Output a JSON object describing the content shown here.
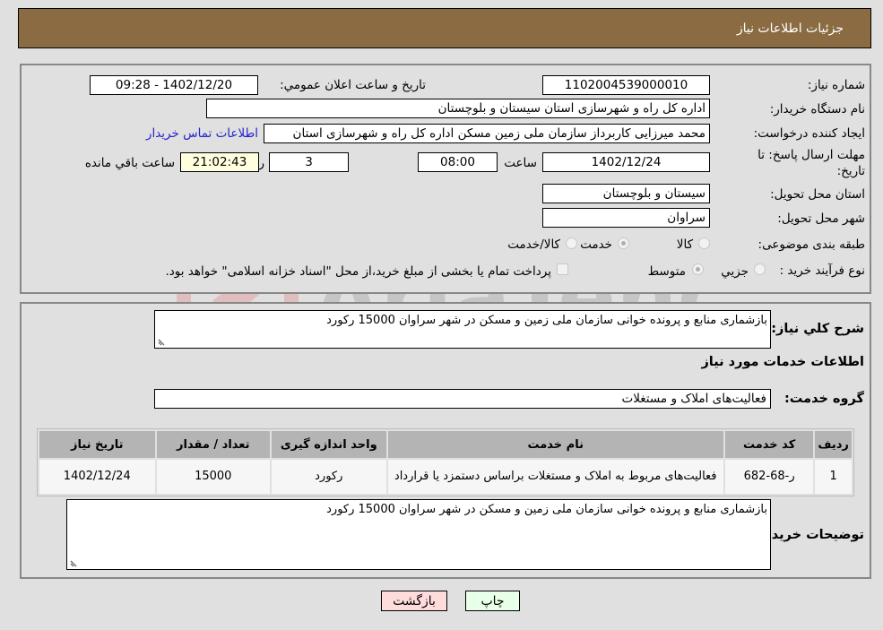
{
  "header": {
    "title": "جزئیات اطلاعات نیاز"
  },
  "form": {
    "need_number": {
      "label": "شماره نیاز:",
      "value": "1102004539000010"
    },
    "announce_datetime": {
      "label": "تاریخ و ساعت اعلان عمومي:",
      "value": "1402/12/20 - 09:28"
    },
    "buyer_org": {
      "label": "نام دستگاه خریدار:",
      "value": "اداره کل راه و شهرسازی استان سیستان و بلوچستان"
    },
    "requester": {
      "label": "ایجاد کننده درخواست:",
      "value": "محمد میرزایی کاربرداز سازمان ملی زمین مسکن اداره کل راه و شهرسازی استان"
    },
    "buyer_contact_link": "اطلاعات تماس خریدار",
    "deadline": {
      "label": "مهلت ارسال پاسخ: تا تاریخ:",
      "date": "1402/12/24",
      "time_label": "ساعت",
      "time": "08:00",
      "days": "3",
      "days_label": "روز و",
      "remaining": "21:02:43",
      "remaining_label": "ساعت باقي مانده"
    },
    "delivery_province": {
      "label": "استان محل تحویل:",
      "value": "سیستان و بلوچستان"
    },
    "delivery_city": {
      "label": "شهر محل تحویل:",
      "value": "سراوان"
    },
    "category": {
      "label": "طبقه بندی موضوعی:",
      "options": [
        "کالا",
        "خدمت",
        "کالا/خدمت"
      ],
      "selected": "خدمت"
    },
    "purchase_type": {
      "label": "نوع فرآیند خرید :",
      "options": [
        "جزیي",
        "متوسط"
      ],
      "selected": "متوسط",
      "treasury_note": "پرداخت تمام یا بخشی از مبلغ خرید،از محل \"اسناد خزانه اسلامی\" خواهد بود."
    }
  },
  "details": {
    "summary_label": "شرح کلي نیاز:",
    "summary_value": "بازشماری منابع و پرونده خوانی سازمان ملی زمین و مسکن در شهر سراوان 15000 رکورد",
    "services_heading": "اطلاعات خدمات مورد نیاز",
    "service_group_label": "گروه خدمت:",
    "service_group_value": "فعالیت‌های  املاک و مستغلات",
    "table": {
      "headers": [
        "ردیف",
        "کد خدمت",
        "نام خدمت",
        "واحد اندازه گیری",
        "تعداد / مقدار",
        "تاریخ نیاز"
      ],
      "rows": [
        [
          "1",
          "ر-68-682",
          "فعالیت‌های مربوط به املاک و مستغلات براساس دستمزد یا قرارداد",
          "رکورد",
          "15000",
          "1402/12/24"
        ]
      ]
    },
    "buyer_notes_label": "توضیحات خریدار:",
    "buyer_notes_value": "بازشماری منابع و پرونده خوانی سازمان ملی زمین و مسکن در شهر سراوان 15000 رکورد"
  },
  "buttons": {
    "print": "چاپ",
    "back": "بازگشت"
  },
  "watermark": {
    "text": "AriaTender.neT"
  },
  "colors": {
    "header_bg": "#8b6c42",
    "link": "#2222cc",
    "back_btn": "#ffdcdc",
    "print_btn": "#e8ffe8",
    "remaining_bg": "#ffffe0"
  }
}
